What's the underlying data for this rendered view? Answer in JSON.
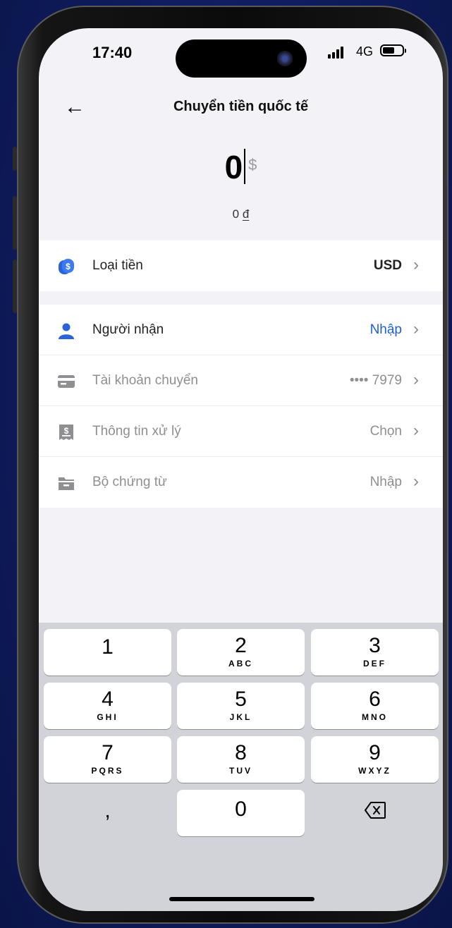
{
  "status_bar": {
    "time": "17:40",
    "network": "4G"
  },
  "header": {
    "title": "Chuyển tiền quốc tế"
  },
  "amount": {
    "value": "0",
    "currency_symbol": "$",
    "converted": "0",
    "converted_unit": "đ"
  },
  "currency_row": {
    "label": "Loại tiền",
    "value": "USD"
  },
  "details": [
    {
      "label": "Người nhận",
      "value": "Nhập",
      "icon": "person-icon"
    },
    {
      "label": "Tài khoản chuyển",
      "value": "•••• 7979",
      "icon": "card-icon"
    },
    {
      "label": "Thông tin xử lý",
      "value": "Chọn",
      "icon": "receipt-icon"
    },
    {
      "label": "Bộ chứng từ",
      "value": "Nhập",
      "icon": "folder-icon"
    }
  ],
  "keypad": {
    "keys": [
      {
        "digit": "1",
        "letters": ""
      },
      {
        "digit": "2",
        "letters": "ABC"
      },
      {
        "digit": "3",
        "letters": "DEF"
      },
      {
        "digit": "4",
        "letters": "GHI"
      },
      {
        "digit": "5",
        "letters": "JKL"
      },
      {
        "digit": "6",
        "letters": "MNO"
      },
      {
        "digit": "7",
        "letters": "PQRS"
      },
      {
        "digit": "8",
        "letters": "TUV"
      },
      {
        "digit": "9",
        "letters": "WXYZ"
      },
      {
        "digit": ",",
        "letters": ""
      },
      {
        "digit": "0",
        "letters": ""
      }
    ]
  },
  "colors": {
    "accent": "#1f5fd6",
    "background": "#f2f2f7",
    "keyboard": "#d1d3d9"
  }
}
